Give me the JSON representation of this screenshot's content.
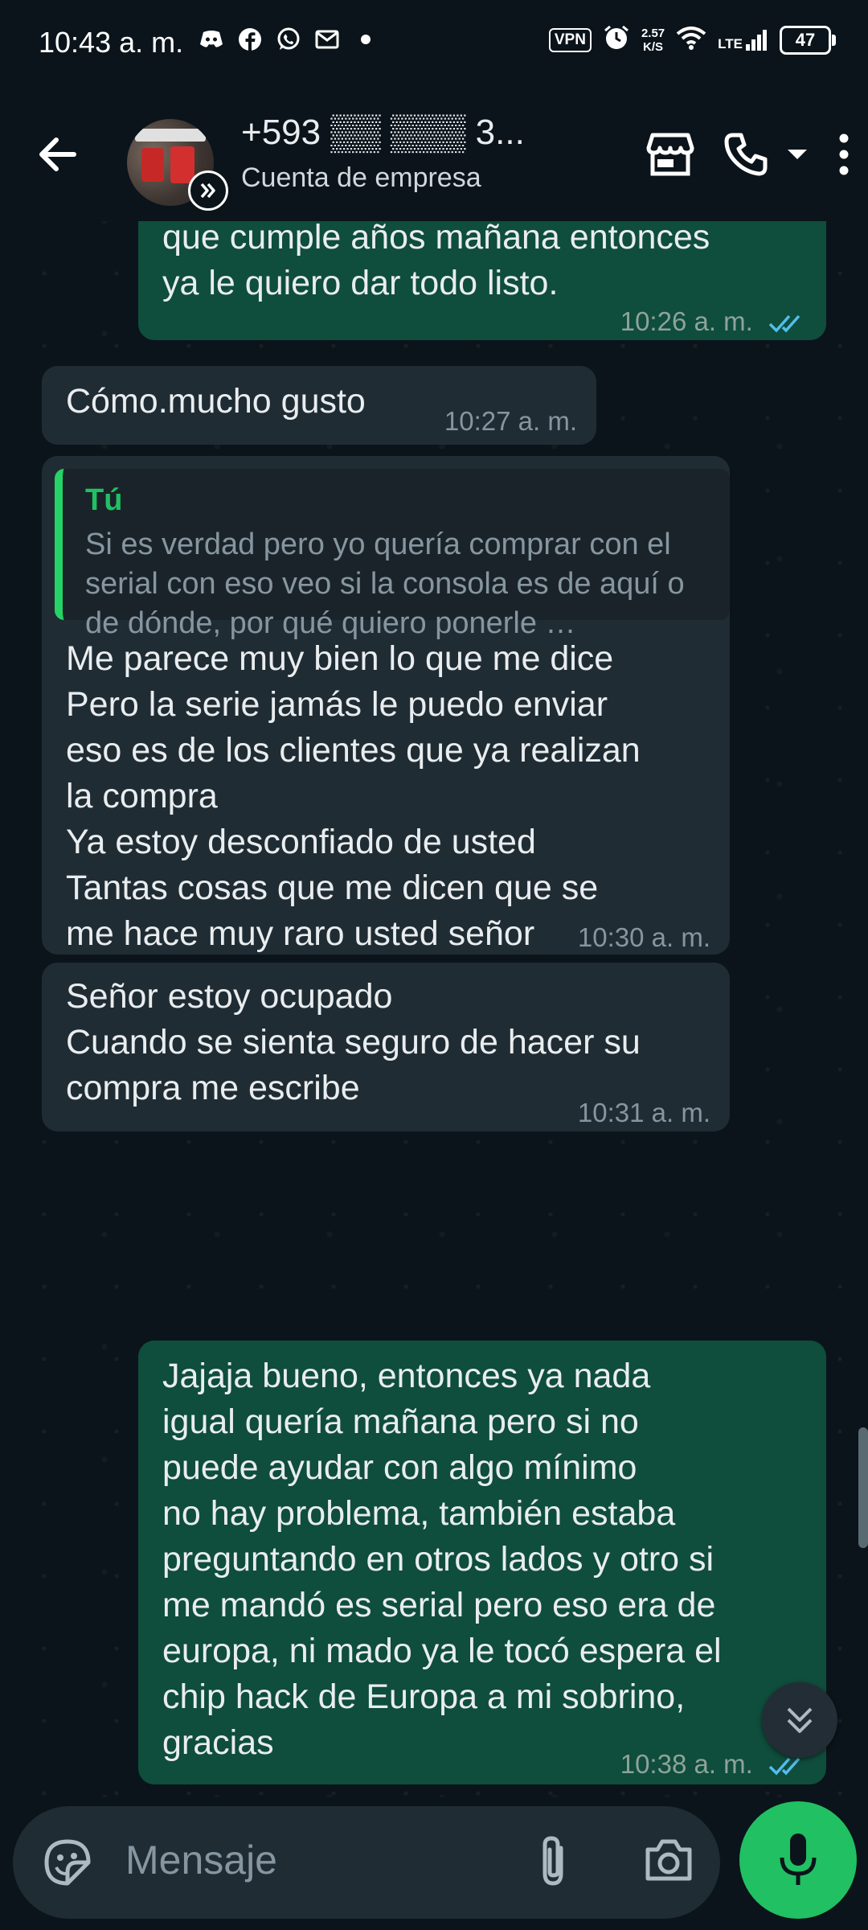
{
  "status_bar": {
    "time": "10:43 a. m.",
    "vpn": "VPN",
    "net_speed_value": "2.57",
    "net_speed_unit": "K/S",
    "network": "LTE",
    "battery": "47"
  },
  "header": {
    "contact_name": "+593 ▒▒ ▒▒▒ 3...",
    "subtitle": "Cuenta de empresa"
  },
  "messages": [
    {
      "direction": "out",
      "text": "que cumple años mañana entonces\nya le quiero dar todo listo.",
      "time": "10:26 a. m.",
      "status": "read"
    },
    {
      "direction": "in",
      "text": "Cómo.mucho gusto",
      "time": "10:27 a. m."
    },
    {
      "direction": "in",
      "quote": {
        "author": "Tú",
        "text": "Si es verdad pero yo quería comprar con el serial con eso veo si la consola es de aquí o de dónde, por qué quiero ponerle …"
      },
      "text": "Me parece muy bien lo que me dice\nPero la serie jamás le puedo enviar\neso es de los clientes que ya realizan\nla compra\nYa estoy desconfiado de usted\nTantas cosas que me dicen que se\nme hace muy raro usted señor\nMejor por qué no se acerca usted a\nnuestro local para que se quite todas\nsus dudas",
      "time": "10:30 a. m."
    },
    {
      "direction": "in",
      "text": "Señor estoy ocupado\nCuando se sienta seguro de hacer su\ncompra me escribe",
      "time": "10:31 a. m."
    },
    {
      "direction": "out",
      "text": "Jajaja bueno, entonces ya nada\nigual quería mañana pero si no\npuede ayudar con algo mínimo\nno hay problema, también estaba\npreguntando en otros lados y otro si\nme mandó es serial pero eso era de\neuropa, ni mado ya le tocó espera el\nchip hack de Europa a mi sobrino,\ngracias",
      "time": "10:38 a. m.",
      "status": "read"
    }
  ],
  "composer": {
    "placeholder": "Mensaje"
  },
  "colors": {
    "background": "#0b141a",
    "incoming_bubble": "#202c33",
    "outgoing_bubble": "#0f4d3c",
    "accent_green": "#21c063",
    "read_ticks": "#53bdeb"
  },
  "icons": {
    "back": "arrow-left-icon",
    "business": "business-badge-icon",
    "store": "store-icon",
    "call": "phone-icon",
    "menu": "more-vert-icon",
    "emoji": "emoji-sticker-icon",
    "attach": "paperclip-icon",
    "camera": "camera-icon",
    "mic": "mic-icon",
    "scroll": "double-chevron-down-icon"
  }
}
